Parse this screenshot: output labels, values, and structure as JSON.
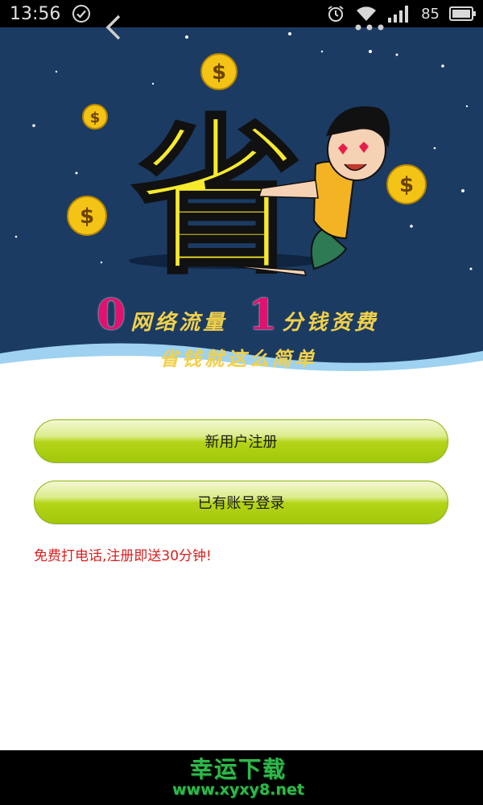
{
  "status_bar": {
    "time": "13:56",
    "battery": "85",
    "icons": [
      "check-circle-icon",
      "alarm-icon",
      "wifi-icon",
      "signal-icon",
      "battery-icon"
    ]
  },
  "banner": {
    "num_zero": "0",
    "line1_a": "网络流量",
    "num_one": "1",
    "line1_b": "分钱资费",
    "line2": "省钱就这么简单",
    "mascot_char": "省",
    "coin_symbol": "$",
    "colors": {
      "background": "#1b3b63",
      "accent_text": "#f2d04a",
      "number": "#e0116f"
    }
  },
  "actions": {
    "register_label": "新用户注册",
    "login_label": "已有账号登录"
  },
  "promo_text": "免费打电话,注册即送30分钟!",
  "nav": {
    "watermark_cn": "幸运下载",
    "watermark_url": "www.xyxy8.net",
    "icons": [
      "back-chevron-icon",
      "more-dots-icon"
    ]
  },
  "colors": {
    "button_green": "#a2c80a",
    "promo_red": "#d81e1e",
    "watermark_green": "#2fb84a"
  }
}
